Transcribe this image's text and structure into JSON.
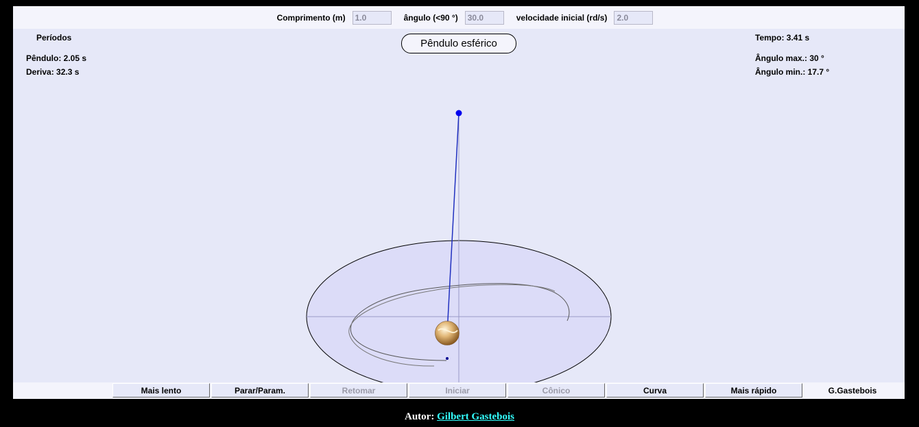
{
  "params": {
    "length_label": "Comprimento (m)",
    "length_value": "1.0",
    "angle_label": "ângulo (<90 °)",
    "angle_value": "30.0",
    "velocity_label": "velocidade inicial (rd/s)",
    "velocity_value": "2.0"
  },
  "info": {
    "periods_heading": "Períodos",
    "pendulum_period": "Pêndulo: 2.05 s",
    "drift_period": "Deriva: 32.3 s",
    "time": "Tempo: 3.41 s",
    "angle_max": "Ângulo max.: 30 °",
    "angle_min": "Ângulo min.: 17.7 °"
  },
  "title": "Pêndulo esférico",
  "buttons": {
    "slower": "Mais lento",
    "stop_params": "Parar/Param.",
    "resume": "Retomar",
    "start": "Iniciar",
    "conical": "Cônico",
    "curve": "Curva",
    "faster": "Mais rápido",
    "author_button": "G.Gastebois"
  },
  "footer": {
    "label": "Autor:",
    "author": "Gilbert Gastebois"
  },
  "colors": {
    "background": "#000000",
    "panel": "#e6e8f8",
    "pivot": "#0000ee",
    "string": "#2030c0",
    "link": "#33ffff"
  }
}
